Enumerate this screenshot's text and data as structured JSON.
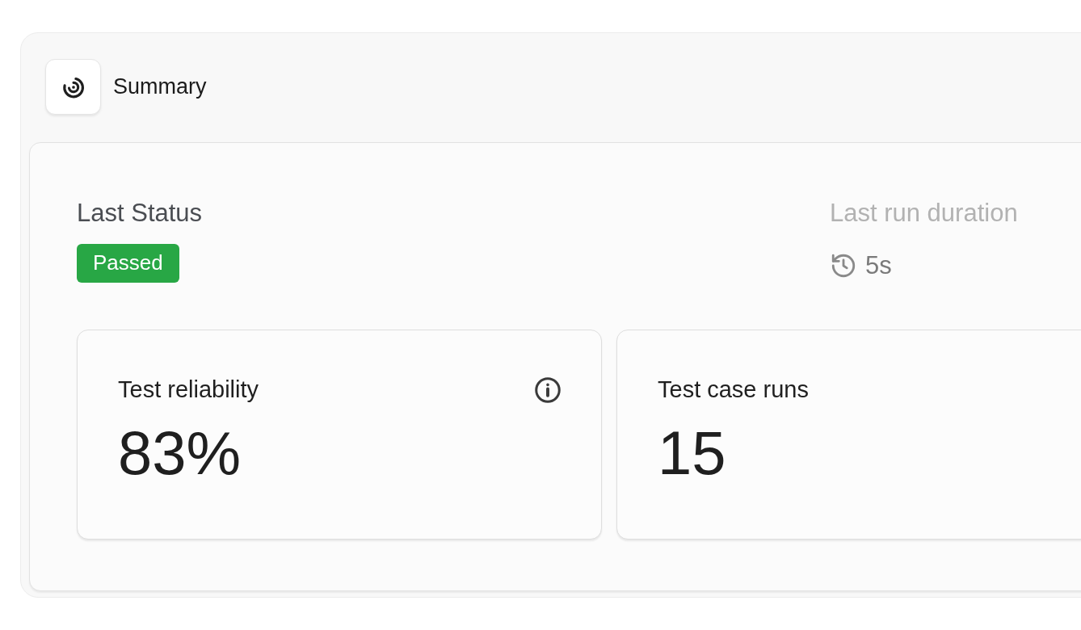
{
  "header": {
    "title": "Summary"
  },
  "last_status": {
    "label": "Last Status",
    "status": {
      "text": "Passed",
      "kind": "success"
    }
  },
  "last_run_duration": {
    "label": "Last run duration",
    "value": "5s"
  },
  "metrics": [
    {
      "title": "Test reliability",
      "value": "83%",
      "info": true
    },
    {
      "title": "Test case runs",
      "value": "15",
      "info": false
    }
  ]
}
